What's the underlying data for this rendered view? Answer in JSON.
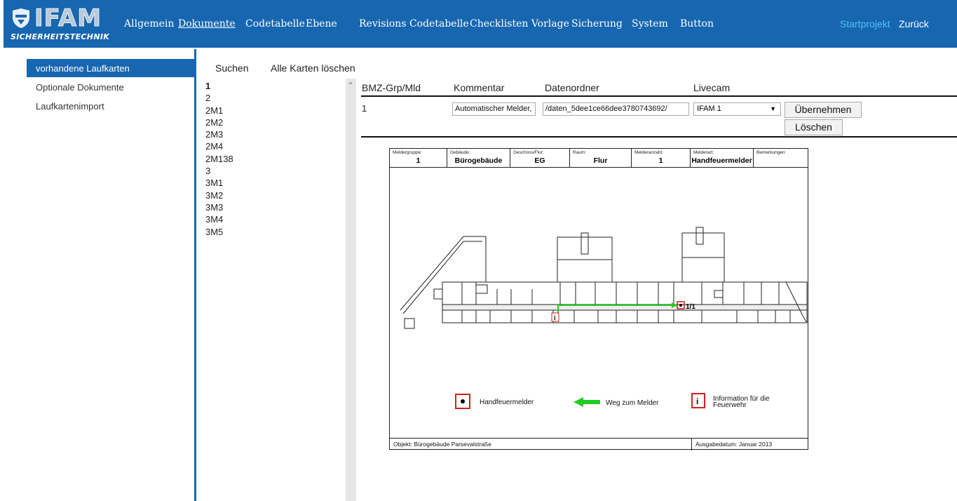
{
  "brand": {
    "name": "IFAM",
    "tagline": "SICHERHEITSTECHNIK"
  },
  "nav": {
    "items": [
      {
        "label": "Allgemein"
      },
      {
        "label": "Dokumente",
        "active": true
      },
      {
        "label": "Codetabelle"
      },
      {
        "label": "Ebene"
      },
      {
        "label": "Revisions Codetabelle"
      },
      {
        "label": "Checklisten Vorlage"
      },
      {
        "label": "Sicherung"
      },
      {
        "label": "System"
      },
      {
        "label": "Button"
      }
    ],
    "startprojekt": "Startprojekt",
    "zurueck": "Zurück",
    "colors": {
      "bar": "#1766b0",
      "startprojekt": "#4fc3f7"
    }
  },
  "sidebar": {
    "items": [
      {
        "label": "vorhandene Laufkarten",
        "active": true
      },
      {
        "label": "Optionale Dokumente"
      },
      {
        "label": "Laufkartenimport"
      }
    ]
  },
  "cards": {
    "search_label": "Suchen",
    "delete_all_label": "Alle Karten löschen",
    "items": [
      "1",
      "2",
      "2M1",
      "2M2",
      "2M3",
      "2M4",
      "2M138",
      "3",
      "3M1",
      "3M2",
      "3M3",
      "3M4",
      "3M5"
    ],
    "selected": "1"
  },
  "table": {
    "headers": {
      "bmz": "BMZ-Grp/Mld",
      "kommentar": "Kommentar",
      "datenordner": "Datenordner",
      "livecam": "Livecam"
    },
    "row": {
      "bmz": "1",
      "kommentar": "Automatischer Melder,",
      "datenordner": "/daten_5dee1ce66dee3780743692/",
      "livecam": "IFAM 1"
    },
    "apply_label": "Übernehmen",
    "delete_label": "Löschen"
  },
  "laufkarte": {
    "header": {
      "meldergruppe": {
        "label": "Meldergruppe:",
        "value": "1"
      },
      "gebaeude": {
        "label": "Gebäude:",
        "value": "Bürogebäude"
      },
      "geschoss": {
        "label": "Geschoss/Flur:",
        "value": "EG"
      },
      "raum": {
        "label": "Raum:",
        "value": "Flur"
      },
      "melderanzahl": {
        "label": "Melderanzahl:",
        "value": "1"
      },
      "melderart": {
        "label": "Melderart:",
        "value": "Handfeuermelder"
      },
      "bemerkungen": {
        "label": "Bemerkungen:",
        "value": ""
      }
    },
    "detector_label": "1/1",
    "legend": {
      "handfeuermelder": "Handfeuermelder",
      "weg": "Weg zum Melder",
      "info_line1": "Information für die",
      "info_line2": "Feuerwehr"
    },
    "footer": {
      "objekt": "Objekt: Bürogebäude Parsevalstraße",
      "ausgabe": "Ausgabedatum: Januar 2013"
    },
    "colors": {
      "marker": "#d21f1f",
      "route": "#22cc22"
    }
  }
}
